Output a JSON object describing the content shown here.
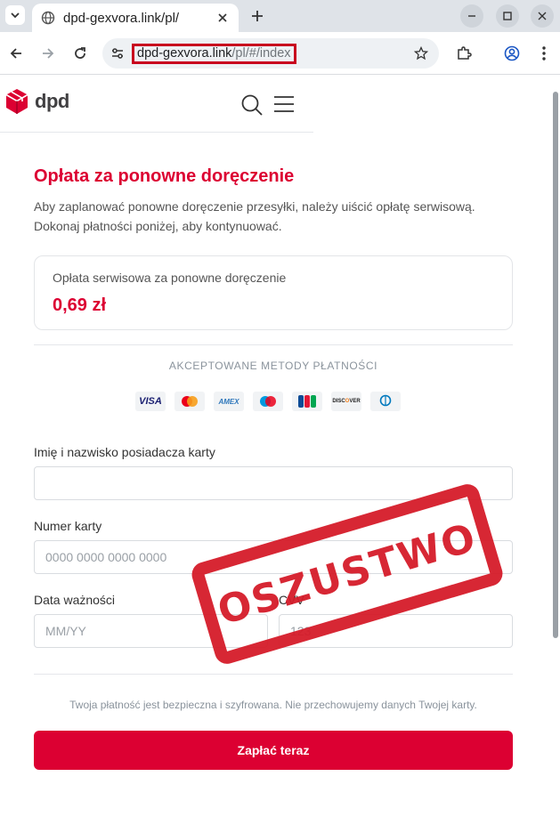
{
  "browser": {
    "tab_title": "dpd-gexvora.link/pl/",
    "url_host": "dpd-gexvora.link",
    "url_path": "/pl/#/index",
    "icons": {
      "tab_list": "chevron-down-icon",
      "tab_favicon": "globe-icon",
      "tab_close": "close-icon",
      "new_tab": "plus-icon",
      "minimize": "minimize-icon",
      "maximize": "maximize-icon",
      "close_window": "close-icon",
      "back": "arrow-left-icon",
      "forward": "arrow-right-icon",
      "reload": "reload-icon",
      "site_info": "tune-icon",
      "bookmark": "star-icon",
      "extensions": "puzzle-icon",
      "profile": "account-icon",
      "menu": "kebab-icon"
    }
  },
  "site": {
    "logo_text": "dpd",
    "colors": {
      "brand": "#dc0032",
      "logo_cube": "#dc0032"
    }
  },
  "page": {
    "title": "Opłata za ponowne doręczenie",
    "intro": "Aby zaplanować ponowne doręczenie przesyłki, należy uiścić opłatę serwisową. Dokonaj płatności poniżej, aby kontynuować.",
    "fee_label": "Opłata serwisowa za ponowne doręczenie",
    "fee_amount": "0,69 zł",
    "methods_label": "AKCEPTOWANE METODY PŁATNOŚCI",
    "payment_methods": [
      {
        "name": "VISA"
      },
      {
        "name": "Mastercard"
      },
      {
        "name": "AMEX"
      },
      {
        "name": "Maestro"
      },
      {
        "name": "JCB"
      },
      {
        "name": "DISCOVER"
      },
      {
        "name": "Diners Club"
      }
    ],
    "form": {
      "cardholder_label": "Imię i nazwisko posiadacza karty",
      "cardholder_value": "",
      "card_number_label": "Numer karty",
      "card_number_placeholder": "0000 0000 0000 0000",
      "expiry_label": "Data ważności",
      "expiry_placeholder": "MM/YY",
      "cvv_label": "CVV",
      "cvv_placeholder": "123"
    },
    "secure_note": "Twoja płatność jest bezpieczna i szyfrowana. Nie przechowujemy danych Twojej karty.",
    "pay_button": "Zapłać teraz"
  },
  "overlay": {
    "stamp_text": "OSZUSTWO",
    "stamp_color": "#d51a28"
  }
}
